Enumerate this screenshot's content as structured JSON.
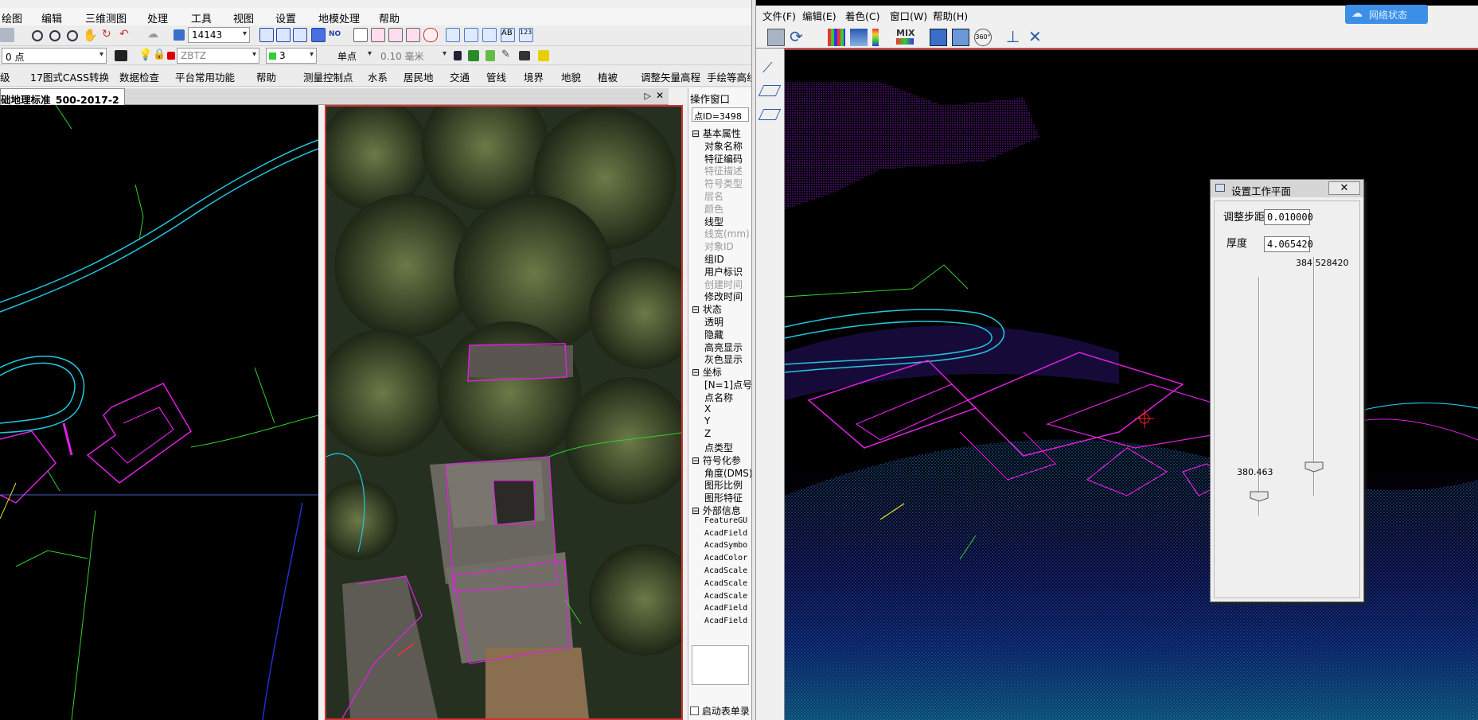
{
  "left": {
    "menu": [
      "绘图",
      "编辑",
      "三维测图",
      "处理",
      "工具",
      "视图",
      "设置",
      "地模处理",
      "帮助"
    ],
    "toolbar1": {
      "scale_value": "14143"
    },
    "toolbar2": {
      "layer": "0 点",
      "layer_name": "ZBTZ",
      "color_value": "3",
      "mode": "单点",
      "linewidth": "0.10 毫米"
    },
    "toolbar3": [
      "级",
      "17图式CASS转换",
      "数据检查",
      "平台常用功能",
      "帮助",
      "测量控制点",
      "水系",
      "居民地",
      "交通",
      "管线",
      "境界",
      "地貌",
      "植被",
      "调整矢量高程",
      "手绘等高线"
    ],
    "doc_tab": "础地理标准_500-2017-2",
    "ops_panel": {
      "title": "操作窗口",
      "point_id": "点ID=3498",
      "rows": [
        {
          "t": "⊟ 基本属性",
          "g": false
        },
        {
          "t": "对象名称",
          "g": false
        },
        {
          "t": "特征编码",
          "g": false
        },
        {
          "t": "特征描述",
          "g": true
        },
        {
          "t": "符号类型",
          "g": true
        },
        {
          "t": "层名",
          "g": true
        },
        {
          "t": "颜色",
          "g": true
        },
        {
          "t": "线型",
          "g": false
        },
        {
          "t": "线宽(mm)",
          "g": true
        },
        {
          "t": "对象ID",
          "g": true
        },
        {
          "t": "组ID",
          "g": false
        },
        {
          "t": "用户标识",
          "g": false
        },
        {
          "t": "创建时间",
          "g": true
        },
        {
          "t": "修改时间",
          "g": false
        },
        {
          "t": "⊟ 状态",
          "g": false
        },
        {
          "t": "透明",
          "g": false
        },
        {
          "t": "隐藏",
          "g": false
        },
        {
          "t": "高亮显示",
          "g": false
        },
        {
          "t": "灰色显示",
          "g": false
        },
        {
          "t": "⊟ 坐标",
          "g": false
        },
        {
          "t": "[N=1]点号",
          "g": false
        },
        {
          "t": "点名称",
          "g": false
        },
        {
          "t": "  X",
          "g": false
        },
        {
          "t": "  Y",
          "g": false
        },
        {
          "t": "  Z",
          "g": false
        },
        {
          "t": "点类型",
          "g": false
        },
        {
          "t": "⊟ 符号化参",
          "g": false
        },
        {
          "t": "角度(DMS)",
          "g": false
        },
        {
          "t": "图形比例",
          "g": false
        },
        {
          "t": "图形特征",
          "g": false
        },
        {
          "t": "⊟ 外部信息",
          "g": false
        },
        {
          "t": "FeatureGU",
          "g": false
        },
        {
          "t": "AcadField",
          "g": false
        },
        {
          "t": "AcadSymbo",
          "g": false
        },
        {
          "t": "AcadColor",
          "g": false
        },
        {
          "t": "AcadScale",
          "g": false
        },
        {
          "t": "AcadScale",
          "g": false
        },
        {
          "t": "AcadScale",
          "g": false
        },
        {
          "t": "AcadField",
          "g": false
        },
        {
          "t": "AcadField",
          "g": false
        }
      ],
      "footer_checkbox": "启动表单录"
    }
  },
  "right": {
    "menu": [
      "文件(F)",
      "编辑(E)",
      "着色(C)",
      "窗口(W)",
      "帮助(H)"
    ],
    "toolbar_labels": {
      "mix": "MIX",
      "deg360": "360°"
    },
    "badge": "网络状态",
    "dialog": {
      "title": "设置工作平面",
      "close": "✕",
      "step_label": "调整步距",
      "step_value": "0.010000",
      "thick_label": "厚度",
      "thick_value": "4.065420",
      "top_value": "384.528420",
      "bottom_value": "380.463",
      "left_slider_level": 0.92,
      "right_slider_level": 0.88
    }
  },
  "colors": {
    "accent_red": "#d43030",
    "magenta": "#e020e0",
    "cyan": "#20c8e0",
    "green": "#30d030"
  }
}
